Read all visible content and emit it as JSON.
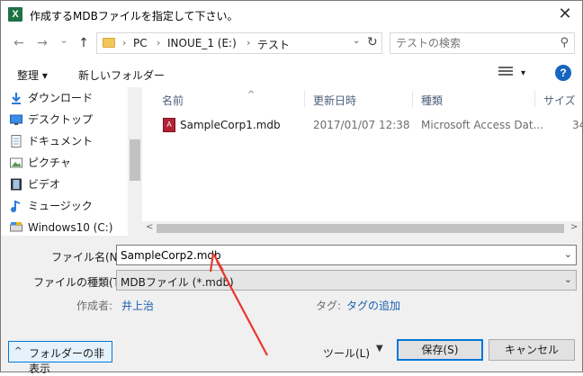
{
  "window": {
    "title": "作成するMDBファイルを指定して下さい。",
    "app_icon": "X",
    "close_glyph": "✕"
  },
  "nav": {
    "back": "←",
    "forward": "→",
    "recent": "⌄",
    "up": "↑",
    "path": [
      "PC",
      "INOUE_1 (E:)",
      "テスト"
    ],
    "sep": "›",
    "dropdown": "⌄",
    "refresh": "↻",
    "search_placeholder": "テストの検索"
  },
  "toolbar": {
    "organize": "整理 ▾",
    "new_folder": "新しいフォルダー",
    "view_arrow": "▾",
    "help": "?"
  },
  "sidebar": {
    "items": [
      {
        "label": "ダウンロード",
        "icon": "download-icon"
      },
      {
        "label": "デスクトップ",
        "icon": "desktop-icon"
      },
      {
        "label": "ドキュメント",
        "icon": "document-icon"
      },
      {
        "label": "ピクチャ",
        "icon": "picture-icon"
      },
      {
        "label": "ビデオ",
        "icon": "video-icon"
      },
      {
        "label": "ミュージック",
        "icon": "music-icon"
      },
      {
        "label": "Windows10 (C:)",
        "icon": "drive-icon"
      }
    ]
  },
  "filelist": {
    "columns": [
      "名前",
      "更新日時",
      "種類",
      "サイズ"
    ],
    "sort_arrow": "^",
    "rows": [
      {
        "name": "SampleCorp1.mdb",
        "modified": "2017/01/07 12:38",
        "type": "Microsoft Access Dat...",
        "size": "34"
      }
    ],
    "scroll_left": "<",
    "scroll_right": ">"
  },
  "form": {
    "filename_label": "ファイル名(N):",
    "filename_value": "SampleCorp2.mdb",
    "filetype_label": "ファイルの種類(T):",
    "filetype_value": "MDBファイル (*.mdb)",
    "combo_arrow": "⌄",
    "author_label": "作成者:",
    "author_value": "井上治",
    "tag_label": "タグ:",
    "tag_value": "タグの追加"
  },
  "buttons": {
    "hide_folders": "フォルダーの非表示",
    "hide_arrow": "^",
    "tools": "ツール(L)",
    "tools_arrow": "▼",
    "save": "保存(S)",
    "cancel": "キャンセル"
  },
  "colors": {
    "annotation_arrow": "#e8382f",
    "accent": "#0078d7",
    "link": "#1d5fb0"
  }
}
